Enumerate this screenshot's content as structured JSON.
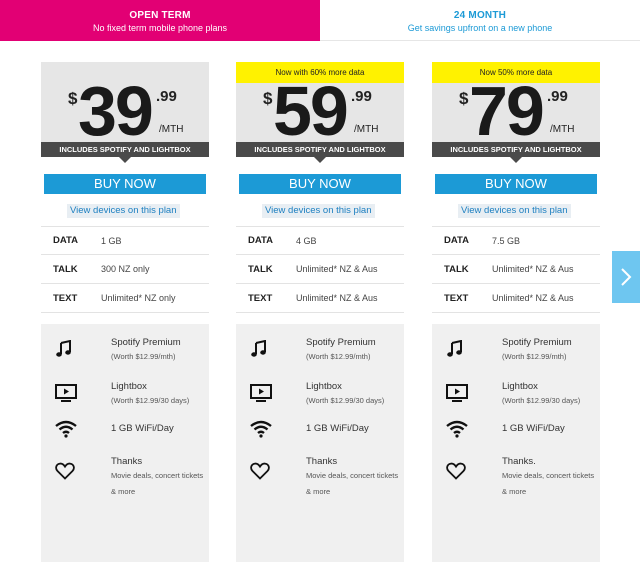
{
  "tabs": [
    {
      "title": "OPEN TERM",
      "subtitle": "No fixed term mobile phone plans",
      "active": true
    },
    {
      "title": "24 MONTH",
      "subtitle": "Get savings upfront on a new phone",
      "active": false
    }
  ],
  "colors": {
    "brand": "#e20074",
    "accent": "#1c9ad6",
    "promo": "#fff200",
    "band": "#4a4a4a"
  },
  "plans": [
    {
      "promo": "",
      "currency": "$",
      "dollars": "39",
      "cents": ".99",
      "period": "/MTH",
      "includes": "INCLUDES SPOTIFY AND LIGHTBOX",
      "buy_label": "BUY NOW",
      "view_label": "View devices on this plan",
      "specs": [
        {
          "key": "DATA",
          "value": "1 GB"
        },
        {
          "key": "TALK",
          "value": "300 NZ only"
        },
        {
          "key": "TEXT",
          "value": "Unlimited* NZ only"
        }
      ],
      "extras": [
        {
          "icon": "music-note-icon",
          "title": "Spotify Premium",
          "note": "(Worth $12.99/mth)"
        },
        {
          "icon": "tv-icon",
          "title": "Lightbox",
          "note": "(Worth $12.99/30 days)"
        },
        {
          "icon": "wifi-icon",
          "title": "1 GB WiFi/Day",
          "note": ""
        },
        {
          "icon": "heart-icon",
          "title": "Thanks",
          "note": "Movie deals, concert tickets & more"
        }
      ]
    },
    {
      "promo": "Now with 60% more data",
      "currency": "$",
      "dollars": "59",
      "cents": ".99",
      "period": "/MTH",
      "includes": "INCLUDES SPOTIFY AND LIGHTBOX",
      "buy_label": "BUY NOW",
      "view_label": "View devices on this plan",
      "specs": [
        {
          "key": "DATA",
          "value": "4 GB"
        },
        {
          "key": "TALK",
          "value": "Unlimited* NZ & Aus"
        },
        {
          "key": "TEXT",
          "value": "Unlimited* NZ & Aus"
        }
      ],
      "extras": [
        {
          "icon": "music-note-icon",
          "title": "Spotify Premium",
          "note": "(Worth $12.99/mth)"
        },
        {
          "icon": "tv-icon",
          "title": "Lightbox",
          "note": "(Worth $12.99/30 days)"
        },
        {
          "icon": "wifi-icon",
          "title": "1 GB WiFi/Day",
          "note": ""
        },
        {
          "icon": "heart-icon",
          "title": "Thanks",
          "note": "Movie deals, concert tickets & more"
        }
      ]
    },
    {
      "promo": "Now 50% more data",
      "currency": "$",
      "dollars": "79",
      "cents": ".99",
      "period": "/MTH",
      "includes": "INCLUDES SPOTIFY AND LIGHTBOX",
      "buy_label": "BUY NOW",
      "view_label": "View devices on this plan",
      "specs": [
        {
          "key": "DATA",
          "value": "7.5 GB"
        },
        {
          "key": "TALK",
          "value": "Unlimited* NZ & Aus"
        },
        {
          "key": "TEXT",
          "value": "Unlimited* NZ & Aus"
        }
      ],
      "extras": [
        {
          "icon": "music-note-icon",
          "title": "Spotify Premium",
          "note": "(Worth $12.99/mth)"
        },
        {
          "icon": "tv-icon",
          "title": "Lightbox",
          "note": "(Worth $12.99/30 days)"
        },
        {
          "icon": "wifi-icon",
          "title": "1 GB WiFi/Day",
          "note": ""
        },
        {
          "icon": "heart-icon",
          "title": "Thanks.",
          "note": "Movie deals, concert tickets & more"
        }
      ]
    }
  ],
  "next_arrow": {
    "icon": "chevron-right-icon"
  }
}
